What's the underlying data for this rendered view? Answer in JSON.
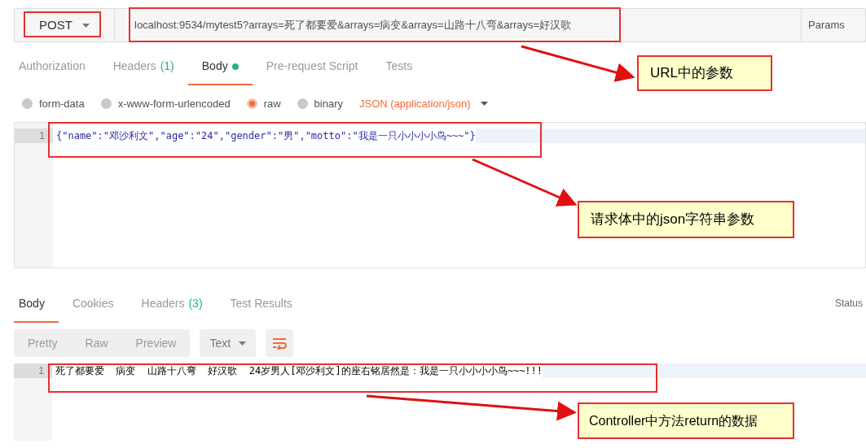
{
  "request": {
    "method": "POST",
    "url": "localhost:9534/mytest5?arrays=死了都要爱&arrays=病变&arrays=山路十八弯&arrays=好汉歌",
    "params_button": "Params",
    "tabs": [
      {
        "label": "Authorization",
        "selected": false
      },
      {
        "label": "Headers",
        "count": "(1)",
        "selected": false
      },
      {
        "label": "Body",
        "dot": true,
        "selected": true
      },
      {
        "label": "Pre-request Script",
        "selected": false
      },
      {
        "label": "Tests",
        "selected": false
      }
    ],
    "body_types": [
      {
        "label": "form-data",
        "selected": false
      },
      {
        "label": "x-www-form-urlencoded",
        "selected": false
      },
      {
        "label": "raw",
        "selected": true
      },
      {
        "label": "binary",
        "selected": false
      }
    ],
    "content_type": "JSON (application/json)",
    "editor": {
      "line_number": "1",
      "code": "{\"name\":\"邓沙利文\",\"age\":\"24\",\"gender\":\"男\",\"motto\":\"我是一只小小小小鸟~~~\"}"
    }
  },
  "response": {
    "tabs": [
      {
        "label": "Body",
        "selected": true
      },
      {
        "label": "Cookies",
        "selected": false
      },
      {
        "label": "Headers",
        "count": "(3)",
        "selected": false
      },
      {
        "label": "Test Results",
        "selected": false
      }
    ],
    "status": "Status",
    "view_modes": [
      {
        "label": "Pretty",
        "selected": false
      },
      {
        "label": "Raw",
        "selected": false
      },
      {
        "label": "Preview",
        "selected": false
      }
    ],
    "format": "Text",
    "editor": {
      "line_number": "1",
      "text": "死了都要爱  病变  山路十八弯  好汉歌  24岁男人[邓沙利文]的座右铭居然是：我是一只小小小小鸟~~~!!!"
    }
  },
  "callouts": [
    "URL中的参数",
    "请求体中的json字符串参数",
    "Controller中方法return的数据"
  ]
}
